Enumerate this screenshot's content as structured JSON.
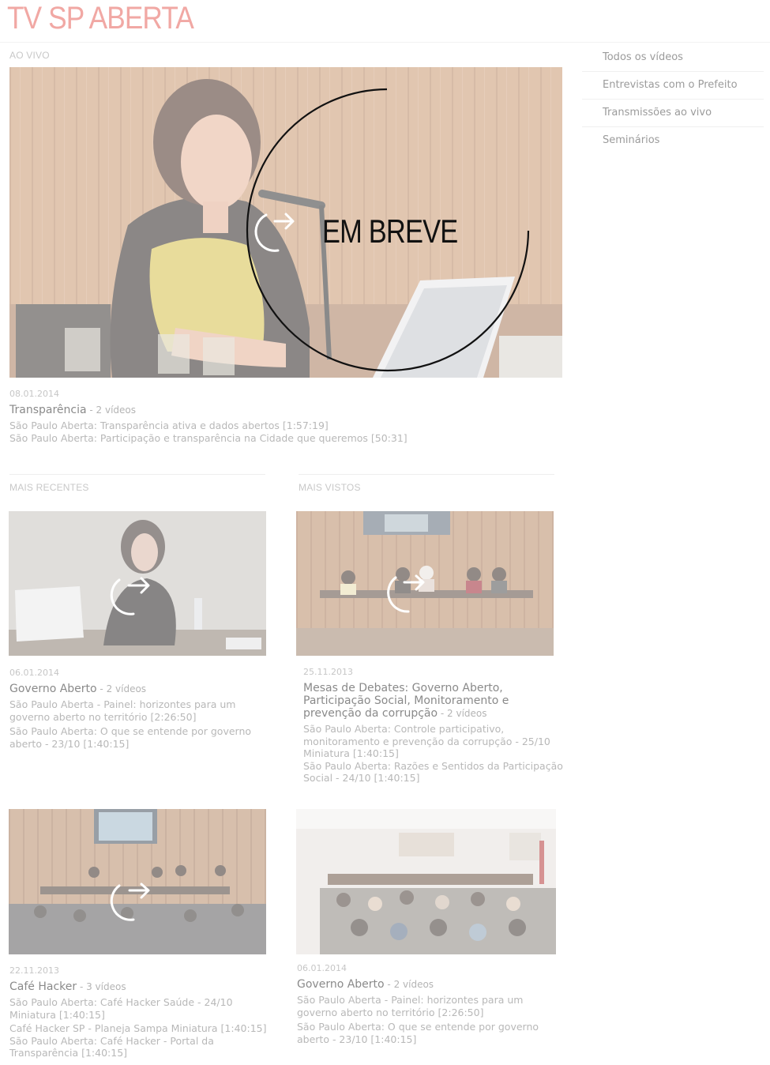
{
  "site": {
    "title": "TV SP ABERTA"
  },
  "sidebar": {
    "items": [
      {
        "label": "Todos os vídeos"
      },
      {
        "label": "Entrevistas com o Prefeito"
      },
      {
        "label": "Transmissões ao vivo"
      },
      {
        "label": "Seminários"
      }
    ]
  },
  "live": {
    "section_label": "AO VIVO",
    "overlay_text": "EM BREVE",
    "date": "08.01.2014",
    "title": "Transparência",
    "count": " - 2 vídeos",
    "videos": [
      "São Paulo Aberta: Transparência ativa e dados abertos [1:57:19]",
      "São Paulo Aberta: Participação e transparência na Cidade que queremos [50:31]"
    ]
  },
  "recent": {
    "section_label": "MAIS RECENTES",
    "items": [
      {
        "date": "06.01.2014",
        "title": "Governo Aberto",
        "count": " - 2 vídeos",
        "videos": [
          "São Paulo Aberta - Painel: horizontes para um governo aberto no território [2:26:50]",
          "São Paulo Aberta: O que se entende por governo aberto - 23/10 [1:40:15]"
        ]
      },
      {
        "date": "22.11.2013",
        "title": "Café Hacker",
        "count": " - 3 vídeos",
        "videos": [
          "São Paulo Aberta: Café Hacker Saúde - 24/10 Miniatura  [1:40:15]",
          "Café Hacker SP - Planeja Sampa Miniatura  [1:40:15]",
          "São Paulo Aberta: Café Hacker - Portal da Transparência [1:40:15]"
        ]
      }
    ]
  },
  "most_viewed": {
    "section_label": "MAIS VISTOS",
    "items": [
      {
        "date": "25.11.2013",
        "title": "Mesas de Debates: Governo Aberto, Participação Social, Monitoramento e prevenção da corrupção",
        "count": " - 2 vídeos",
        "videos": [
          "São Paulo Aberta: Controle participativo, monitoramento e prevenção da corrupção - 25/10 Miniatura [1:40:15]",
          "São Paulo Aberta: Razões e Sentidos da Participação Social - 24/10 [1:40:15]"
        ]
      },
      {
        "date": "06.01.2014",
        "title": "Governo Aberto",
        "count": " - 2 vídeos",
        "videos": [
          "São Paulo Aberta - Painel: horizontes para um governo aberto no território [2:26:50]",
          "São Paulo Aberta: O que se entende por governo aberto - 23/10 [1:40:15]"
        ]
      }
    ]
  },
  "colors": {
    "title_pink": "#f1a8a4",
    "wood": "#c99a78",
    "text_gray": "#9a9a9a"
  }
}
